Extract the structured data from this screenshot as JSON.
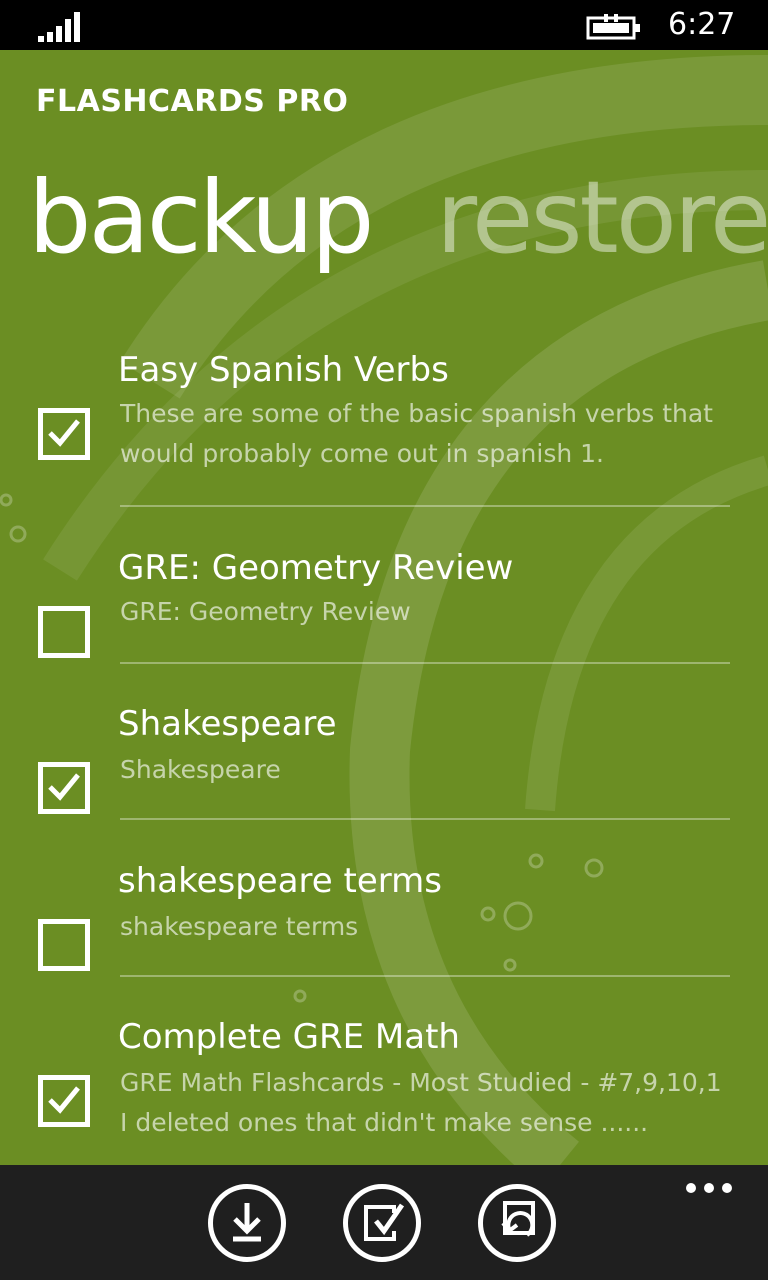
{
  "status": {
    "time": "6:27"
  },
  "app": {
    "title": "FLASHCARDS PRO"
  },
  "pivot": {
    "active": "backup",
    "inactive": "restore"
  },
  "decks": [
    {
      "title": "Easy Spanish Verbs",
      "checked": true,
      "desc_lines": [
        "These are some of the basic spanish verbs that",
        "would probably come out in spanish 1."
      ]
    },
    {
      "title": "GRE: Geometry Review",
      "checked": false,
      "desc_lines": [
        "GRE: Geometry Review"
      ]
    },
    {
      "title": "Shakespeare",
      "checked": true,
      "desc_lines": [
        "Shakespeare"
      ]
    },
    {
      "title": "shakespeare terms",
      "checked": false,
      "desc_lines": [
        "shakespeare terms"
      ]
    },
    {
      "title": "Complete GRE Math",
      "checked": true,
      "desc_lines": [
        "GRE Math Flashcards - Most Studied - #7,9,10,1",
        "I deleted ones that didn't make sense ......"
      ]
    }
  ],
  "app_bar": {
    "buttons": [
      {
        "name": "download-icon"
      },
      {
        "name": "select-all-icon"
      },
      {
        "name": "restore-icon"
      }
    ],
    "more": "more-options-icon"
  },
  "colors": {
    "accent": "#6b8e23",
    "app_bar": "#1f1f1f",
    "status_bar": "#000000"
  }
}
